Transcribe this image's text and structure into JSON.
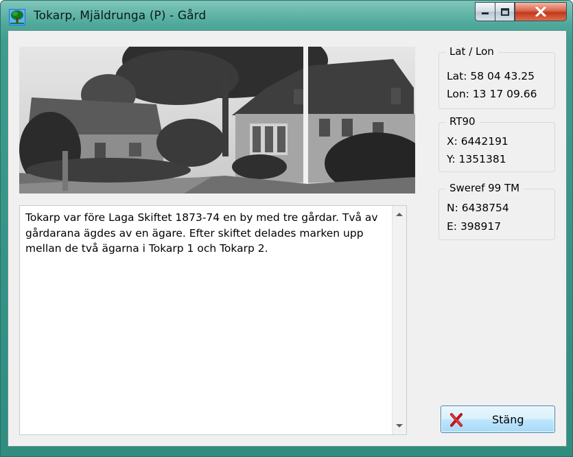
{
  "window": {
    "title": "Tokarp, Mjäldrunga (P) - Gård",
    "icons": {
      "app": "tree-icon",
      "minimize": "minimize-icon",
      "maximize": "maximize-icon",
      "close": "close-icon"
    }
  },
  "description": {
    "text": "Tokarp var före Laga Skiftet 1873-74 en by med tre gårdar. Två av gårdarana ägdes av en ägare. Efter skiftet delades marken upp mellan de två ägarna i Tokarp 1 och Tokarp 2."
  },
  "coordinates": {
    "latlon": {
      "title": "Lat / Lon",
      "lat": "Lat: 58 04 43.25",
      "lon": "Lon: 13 17 09.66"
    },
    "rt90": {
      "title": "RT90",
      "x": "X: 6442191",
      "y": "Y: 1351381"
    },
    "sweref": {
      "title": "Sweref 99 TM",
      "n": "N: 6438754",
      "e": "E: 398917"
    }
  },
  "close_button": {
    "label": "Stäng",
    "icon": "red-x-icon"
  },
  "colors": {
    "title_bar": "#4fa99b",
    "client_bg": "#f0f0f0",
    "close_control": "#c2381d",
    "button_x": "#c0161c"
  }
}
